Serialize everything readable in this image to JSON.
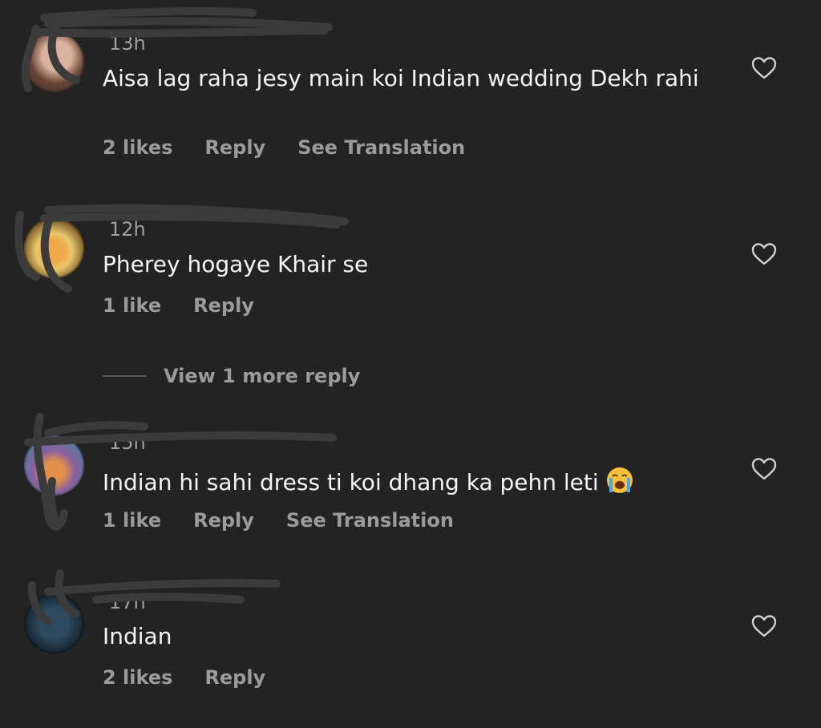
{
  "comments": [
    {
      "username": "",
      "time": "13h",
      "text": "Aisa lag raha jesy main koi Indian wedding Dekh rahi",
      "likes": "2 likes",
      "reply": "Reply",
      "translate": "See Translation",
      "avatar_colors": [
        "#c9a089",
        "#5a3a32"
      ]
    },
    {
      "username": "",
      "time": "12h",
      "text": "Pherey hogaye Khair se",
      "likes": "1 like",
      "reply": "Reply",
      "avatar_colors": [
        "#e9b84a",
        "#6d4a1c"
      ]
    },
    {
      "username": "",
      "time": "15h",
      "text": "Indian hi sahi dress ti koi dhang ka pehn leti",
      "likes": "1 like",
      "reply": "Reply",
      "translate": "See Translation",
      "emoji": "crying-face-emoji",
      "avatar_colors": [
        "#7a5a9a",
        "#d28b4a"
      ]
    },
    {
      "username": "",
      "time": "17h",
      "text": "Indian",
      "likes": "2 likes",
      "reply": "Reply",
      "avatar_colors": [
        "#233647",
        "#0d1520"
      ]
    }
  ],
  "view_more": "View 1 more reply",
  "icons": {
    "like": "heart-outline-icon"
  },
  "colors": {
    "background": "#232323",
    "text": "#f5f5f5",
    "secondary": "#9b9b9b"
  }
}
